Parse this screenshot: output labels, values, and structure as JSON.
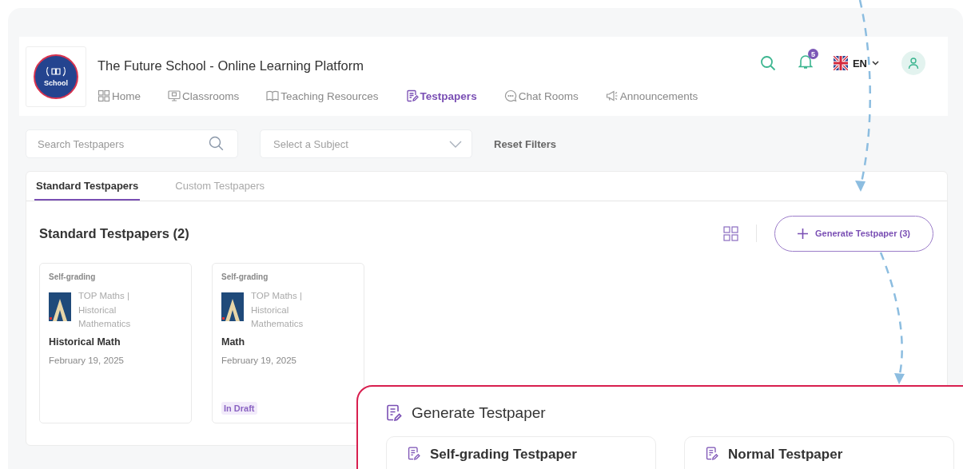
{
  "header": {
    "logo_text": "School",
    "title": "The Future School - Online Learning Platform",
    "notification_count": "5",
    "language": "EN",
    "nav": [
      {
        "label": "Home",
        "selected": false
      },
      {
        "label": "Classrooms",
        "selected": false
      },
      {
        "label": "Teaching Resources",
        "selected": false
      },
      {
        "label": "Testpapers",
        "selected": true
      },
      {
        "label": "Chat Rooms",
        "selected": false
      },
      {
        "label": "Announcements",
        "selected": false
      }
    ]
  },
  "filters": {
    "search": {
      "placeholder": "Search Testpapers"
    },
    "subject": {
      "placeholder": "Select a Subject"
    },
    "reset": "Reset Filters"
  },
  "tabs": [
    {
      "label": "Standard Testpapers",
      "selected": true
    },
    {
      "label": "Custom Testpapers",
      "selected": false
    }
  ],
  "section": {
    "title": "Standard Testpapers (2)",
    "generate_button": "Generate Testpaper (3)"
  },
  "cards": [
    {
      "tag": "Self-grading",
      "book": "TOP Maths | Historical Mathematics",
      "title": "Historical Math",
      "date": "February 19, 2025"
    },
    {
      "tag": "Self-grading",
      "book": "TOP Maths | Historical Mathematics",
      "title": "Math",
      "date": "February 19, 2025",
      "status": "In Draft"
    }
  ],
  "popup": {
    "title": "Generate Testpaper",
    "options": [
      "Self-grading Testpaper",
      "Normal Testpaper"
    ]
  }
}
